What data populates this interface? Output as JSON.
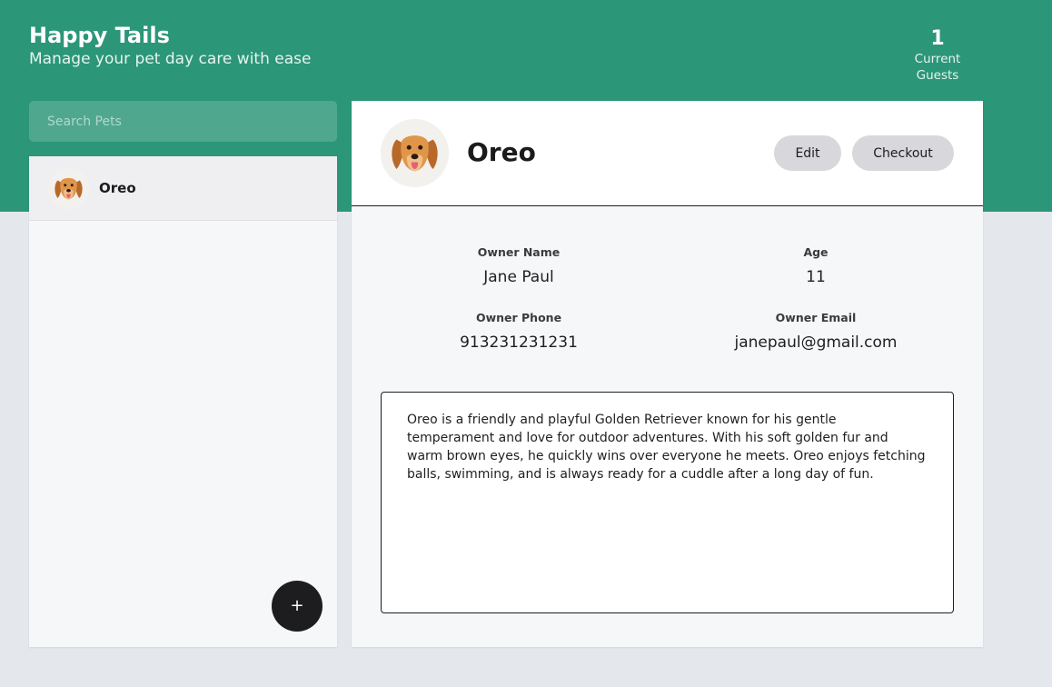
{
  "header": {
    "title": "Happy Tails",
    "subtitle": "Manage your pet day care with ease",
    "guests_count": "1",
    "guests_label": "Current Guests"
  },
  "search": {
    "placeholder": "Search Pets",
    "value": ""
  },
  "pet_list": {
    "items": [
      {
        "name": "Oreo",
        "avatar": "golden-retriever-photo"
      }
    ],
    "add_label": "+"
  },
  "selected_pet": {
    "name": "Oreo",
    "avatar": "golden-retriever-photo",
    "edit_label": "Edit",
    "checkout_label": "Checkout",
    "owner_name_label": "Owner Name",
    "owner_name": "Jane Paul",
    "age_label": "Age",
    "age": "11",
    "owner_phone_label": "Owner Phone",
    "owner_phone": "913231231231",
    "owner_email_label": "Owner Email",
    "owner_email": "janepaul@gmail.com",
    "notes": "Oreo is a friendly and playful Golden Retriever known for his gentle temperament and love for outdoor adventures. With his soft golden fur and warm brown eyes, he quickly wins over everyone he meets. Oreo enjoys fetching balls, swimming, and is always ready for a cuddle after a long day of fun."
  },
  "colors": {
    "brand": "#2c9678",
    "page_background": "#e4e7eb",
    "panel_background": "#f6f7f9",
    "button_gray": "#d8d8dc",
    "fab": "#1d1d20"
  }
}
